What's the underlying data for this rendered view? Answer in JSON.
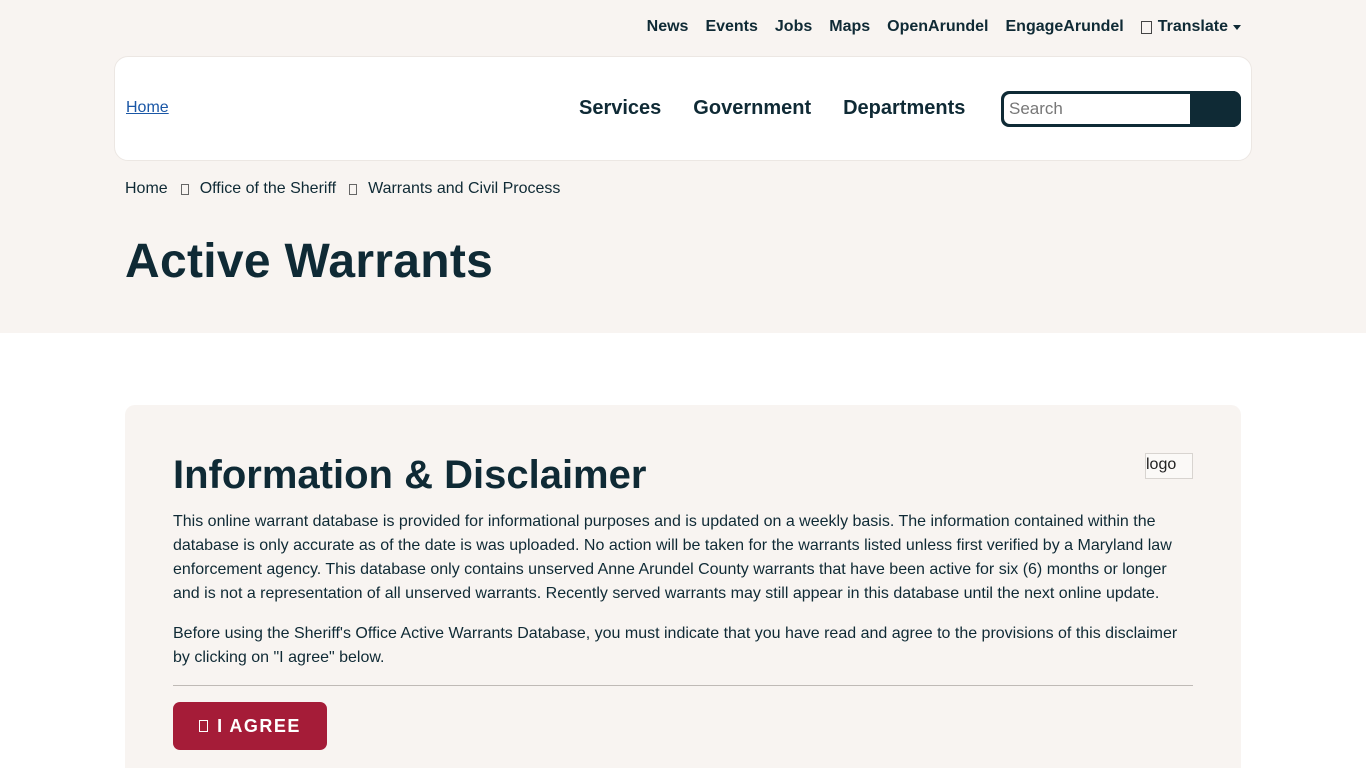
{
  "utility_nav": {
    "links": [
      "News",
      "Events",
      "Jobs",
      "Maps",
      "OpenArundel",
      "EngageArundel"
    ],
    "translate_label": "Translate"
  },
  "header": {
    "logo_alt": "Home",
    "nav": [
      "Services",
      "Government",
      "Departments"
    ],
    "search_placeholder": "Search"
  },
  "breadcrumb": {
    "items": [
      "Home",
      "Office of the Sheriff",
      "Warrants and Civil Process"
    ]
  },
  "page": {
    "title": "Active Warrants"
  },
  "disclaimer": {
    "title": "Information & Disclaimer",
    "logo_alt": "logo",
    "paragraph1": "This online warrant database is provided for informational purposes and is updated on a weekly basis. The information contained within the database is only accurate as of the date is was uploaded. No action will be taken for the warrants listed unless first verified by a Maryland law enforcement agency. This database only contains unserved Anne Arundel County warrants that have been active for six (6) months or longer and is not a representation of all unserved warrants. Recently served warrants may still appear in this database until the next online update.",
    "paragraph2": "Before using the Sheriff's Office Active Warrants Database, you must indicate that you have read and agree to the provisions of this disclaimer by clicking on \"I agree\" below.",
    "agree_label": "I AGREE"
  },
  "colors": {
    "navy": "#0f2a35",
    "band": "#f8f4f1",
    "agree_red": "#a51c38"
  }
}
